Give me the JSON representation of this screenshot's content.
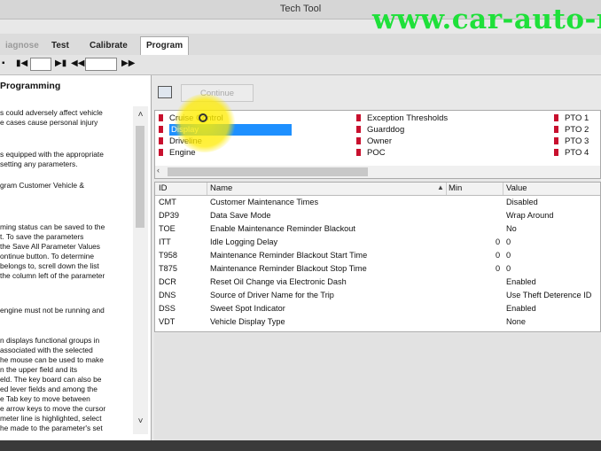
{
  "window": {
    "title": "Tech Tool"
  },
  "watermark": "www.car-auto-re",
  "tabs": [
    {
      "label": "iagnose",
      "state": "disabled"
    },
    {
      "label": "Test",
      "state": "normal"
    },
    {
      "label": "Calibrate",
      "state": "normal"
    },
    {
      "label": "Program",
      "state": "active"
    }
  ],
  "nav": {
    "first": "▪",
    "play": "▶▮",
    "prev": "▮◀",
    "next": "▶▮",
    "rewind": "◀◀",
    "forward": "▶▶"
  },
  "help": {
    "heading": "Programming",
    "lines": [
      "s could adversely affect vehicle",
      "e cases cause personal injury",
      "s equipped with the appropriate",
      "setting any parameters.",
      "gram Customer Vehicle &",
      "ming status can be saved to the",
      "t. To save the parameters",
      "the Save All Parameter Values",
      "ontinue button. To determine",
      "belongs to, screll down the list",
      "the column left of the parameter",
      "engine must not be running and",
      "n displays functional groups in",
      "associated with the selected",
      "he mouse can be used to make",
      "n the upper field and its",
      "eld. The key board can also be",
      "ed lever fields and among the",
      "e Tab key to move between",
      "e arrow keys to move the cursor",
      "meter line is highlighted, select",
      "he made to the parameter's set"
    ]
  },
  "toolbar": {
    "continue_label": "Continue"
  },
  "groups": [
    {
      "label": "Cruise Control",
      "selected": false
    },
    {
      "label": "Display",
      "selected": true
    },
    {
      "label": "Driveline",
      "selected": false
    },
    {
      "label": "Engine",
      "selected": false
    },
    {
      "label": "Exception Thresholds",
      "selected": false
    },
    {
      "label": "Guarddog",
      "selected": false
    },
    {
      "label": "Owner",
      "selected": false
    },
    {
      "label": "POC",
      "selected": false
    },
    {
      "label": "PTO 1",
      "selected": false
    },
    {
      "label": "PTO 2",
      "selected": false
    },
    {
      "label": "PTO 3",
      "selected": false
    },
    {
      "label": "PTO 4",
      "selected": false
    }
  ],
  "params": {
    "headers": {
      "id": "ID",
      "name": "Name",
      "min": "Min",
      "value": "Value"
    },
    "rows": [
      {
        "id": "CMT",
        "name": "Customer Maintenance Times",
        "min": "",
        "value": "Disabled"
      },
      {
        "id": "DP39",
        "name": "Data Save Mode",
        "min": "",
        "value": "Wrap Around"
      },
      {
        "id": "TOE",
        "name": "Enable Maintenance Reminder Blackout",
        "min": "",
        "value": "No"
      },
      {
        "id": "ITT",
        "name": "Idle Logging Delay",
        "min": "0",
        "value": "0"
      },
      {
        "id": "T958",
        "name": "Maintenance Reminder Blackout Start Time",
        "min": "0",
        "value": "0"
      },
      {
        "id": "T875",
        "name": "Maintenance Reminder Blackout Stop Time",
        "min": "0",
        "value": "0"
      },
      {
        "id": "DCR",
        "name": "Reset Oil Change via Electronic Dash",
        "min": "",
        "value": "Enabled"
      },
      {
        "id": "DNS",
        "name": "Source of Driver Name for the Trip",
        "min": "",
        "value": "Use Theft Deterence ID"
      },
      {
        "id": "DSS",
        "name": "Sweet Spot Indicator",
        "min": "",
        "value": "Enabled"
      },
      {
        "id": "VDT",
        "name": "Vehicle Display Type",
        "min": "",
        "value": "None"
      }
    ]
  },
  "colors": {
    "selection": "#1e90ff",
    "watermark": "#1fe03a",
    "marker": "#c8102e"
  }
}
